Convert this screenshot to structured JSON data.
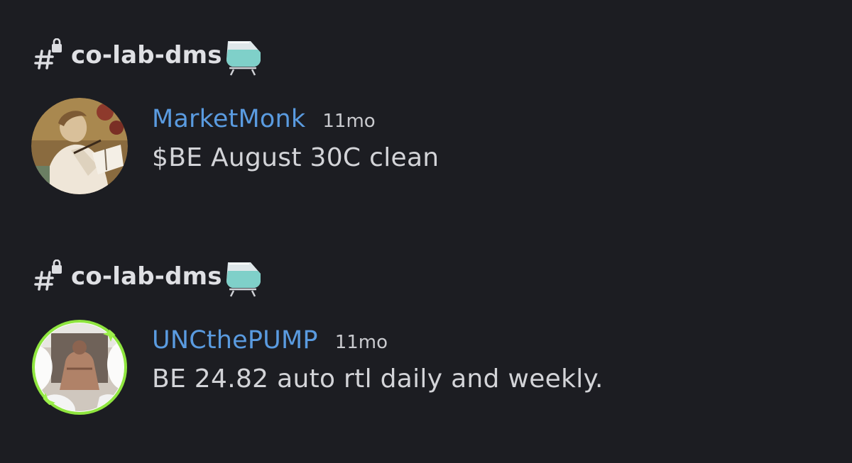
{
  "colors": {
    "background": "#1c1d22",
    "username": "#5a9be0",
    "text": "#d3d4d8",
    "avatar_ring_accent": "#8fe53f"
  },
  "messages": [
    {
      "channel": {
        "name": "co-lab-dms",
        "icon": "hashtag-lock-icon",
        "emoji": "flask-icon"
      },
      "author": "MarketMonk",
      "timestamp": "11mo",
      "text": "$BE August 30C clean",
      "avatar": "avatar-monk"
    },
    {
      "channel": {
        "name": "co-lab-dms",
        "icon": "hashtag-lock-icon",
        "emoji": "flask-icon"
      },
      "author": "UNCthePUMP",
      "timestamp": "11mo",
      "text": "BE 24.82 auto rtl daily and weekly.",
      "avatar": "avatar-gym"
    }
  ]
}
